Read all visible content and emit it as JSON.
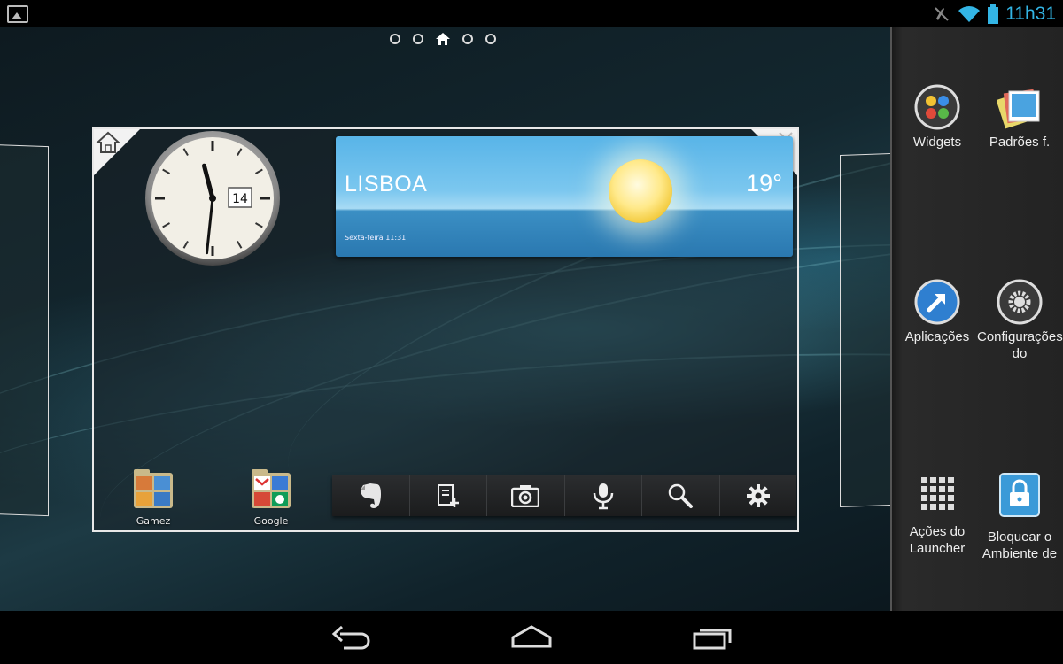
{
  "status_bar": {
    "time": "11h31",
    "icons": [
      "gallery-icon",
      "mute-icon",
      "wifi-icon",
      "battery-icon"
    ],
    "clock_color": "#33b5e5"
  },
  "home_screen": {
    "page_indicator": {
      "pages": 5,
      "current": 3
    },
    "clock_widget": {
      "date": "14",
      "hour": 11,
      "minute": 31
    },
    "weather_widget": {
      "city": "LISBOA",
      "temperature": "19°",
      "date_time": "Sexta-feira 11:31",
      "condition": "sun-icon"
    },
    "folders": [
      {
        "label": "Gamez"
      },
      {
        "label": "Google"
      }
    ],
    "toolbar": [
      "evernote-icon",
      "new-note-icon",
      "camera-icon",
      "voice-search-icon",
      "search-icon",
      "settings-icon"
    ]
  },
  "drawer": {
    "items": [
      {
        "label": "Widgets",
        "icon": "widgets-icon"
      },
      {
        "label": "Padrões f.",
        "icon": "wallpapers-icon"
      },
      {
        "label": "Aplicações",
        "icon": "applications-icon"
      },
      {
        "label": "Configurações do",
        "icon": "settings-icon"
      },
      {
        "label": "Ações do Launcher",
        "icon": "launcher-actions-icon"
      },
      {
        "label": "Bloquear o Ambiente de",
        "icon": "lock-icon"
      }
    ]
  },
  "nav_bar": [
    "back-icon",
    "home-icon",
    "recents-icon"
  ]
}
